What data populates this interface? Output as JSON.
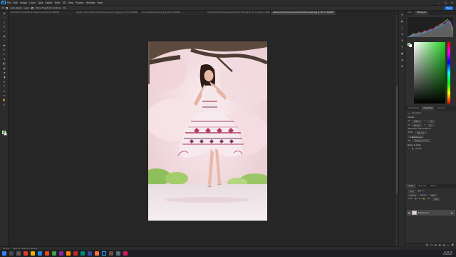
{
  "app": {
    "menu": [
      "File",
      "Edit",
      "Image",
      "Layer",
      "Type",
      "Select",
      "Filter",
      "3D",
      "View",
      "Plugins",
      "Window",
      "Help"
    ],
    "window_controls": [
      "–",
      "□",
      "✕"
    ]
  },
  "options_bar": {
    "preset": "Auto-Select",
    "layer": "Layer",
    "show_transform": "Show Transform Controls",
    "share_label": "Share"
  },
  "tabs": [
    {
      "label": "Fall Interactive wedding images Lyre @ 16.7% (RGB/8)",
      "active": false
    },
    {
      "label": "purple cosmos stolen rushes studio (new) copy.jpg @ 33.3% (RGB/8)",
      "active": false
    },
    {
      "label": "prom-camera-test-tip.jpg @ 16.7% (RGB/8)",
      "active": false
    },
    {
      "label": "in-the-vanilla-fire-tulip-wild-pink-photo-ffd.jpg @ 16.7% (Layer 0, RGB/8)",
      "active": false
    },
    {
      "label": "sakura-cherry-blossom-pixlr-photoshoot-japan.jpg @ 16.7% (RGB/8)*",
      "active": true
    }
  ],
  "status": {
    "zoom": "16.67%",
    "doc": "3000 px x 4500 px (300 ppi)"
  },
  "right_panel": {
    "top_tabs": [
      "Color",
      "Histogram"
    ],
    "mid_tabs": [
      "Adjustments",
      "Properties",
      "Libraries"
    ],
    "props_title": "Document",
    "canvas_label": "Canvas",
    "w_label": "W",
    "w_value": "3000 px",
    "h_label": "H",
    "h_value": "4500 px",
    "x_label": "X",
    "x_value": "0 px",
    "y_label": "Y",
    "y_value": "0 px",
    "resolution": "Resolution: 300 pixels/inch",
    "mode_label": "Mode",
    "mode_value": "RGB Color",
    "depth_value": "8 Bits/Channel",
    "fill_label": "Fill",
    "fill_value": "Background Color",
    "rulers_label": "Rulers & Grids",
    "guides_label": "Guides",
    "layer_tabs": [
      "Layers",
      "Channels",
      "Paths"
    ],
    "layer_kind": "Kind",
    "blend_mode": "Normal",
    "opacity_label": "Opacity:",
    "opacity_value": "100%",
    "lock_label": "Lock:",
    "fill2_label": "Fill:",
    "fill2_value": "100%",
    "layer_name": "Background",
    "bottom_icons": [
      "fx",
      "◐",
      "▣",
      "▤",
      "+",
      "🗑"
    ]
  },
  "taskbar": {
    "time": "10:48 AM",
    "date": "4/18/2023"
  },
  "colors": {
    "foreground": "#2dbb2d",
    "background": "#ffffff",
    "accent": "#1473e6"
  }
}
